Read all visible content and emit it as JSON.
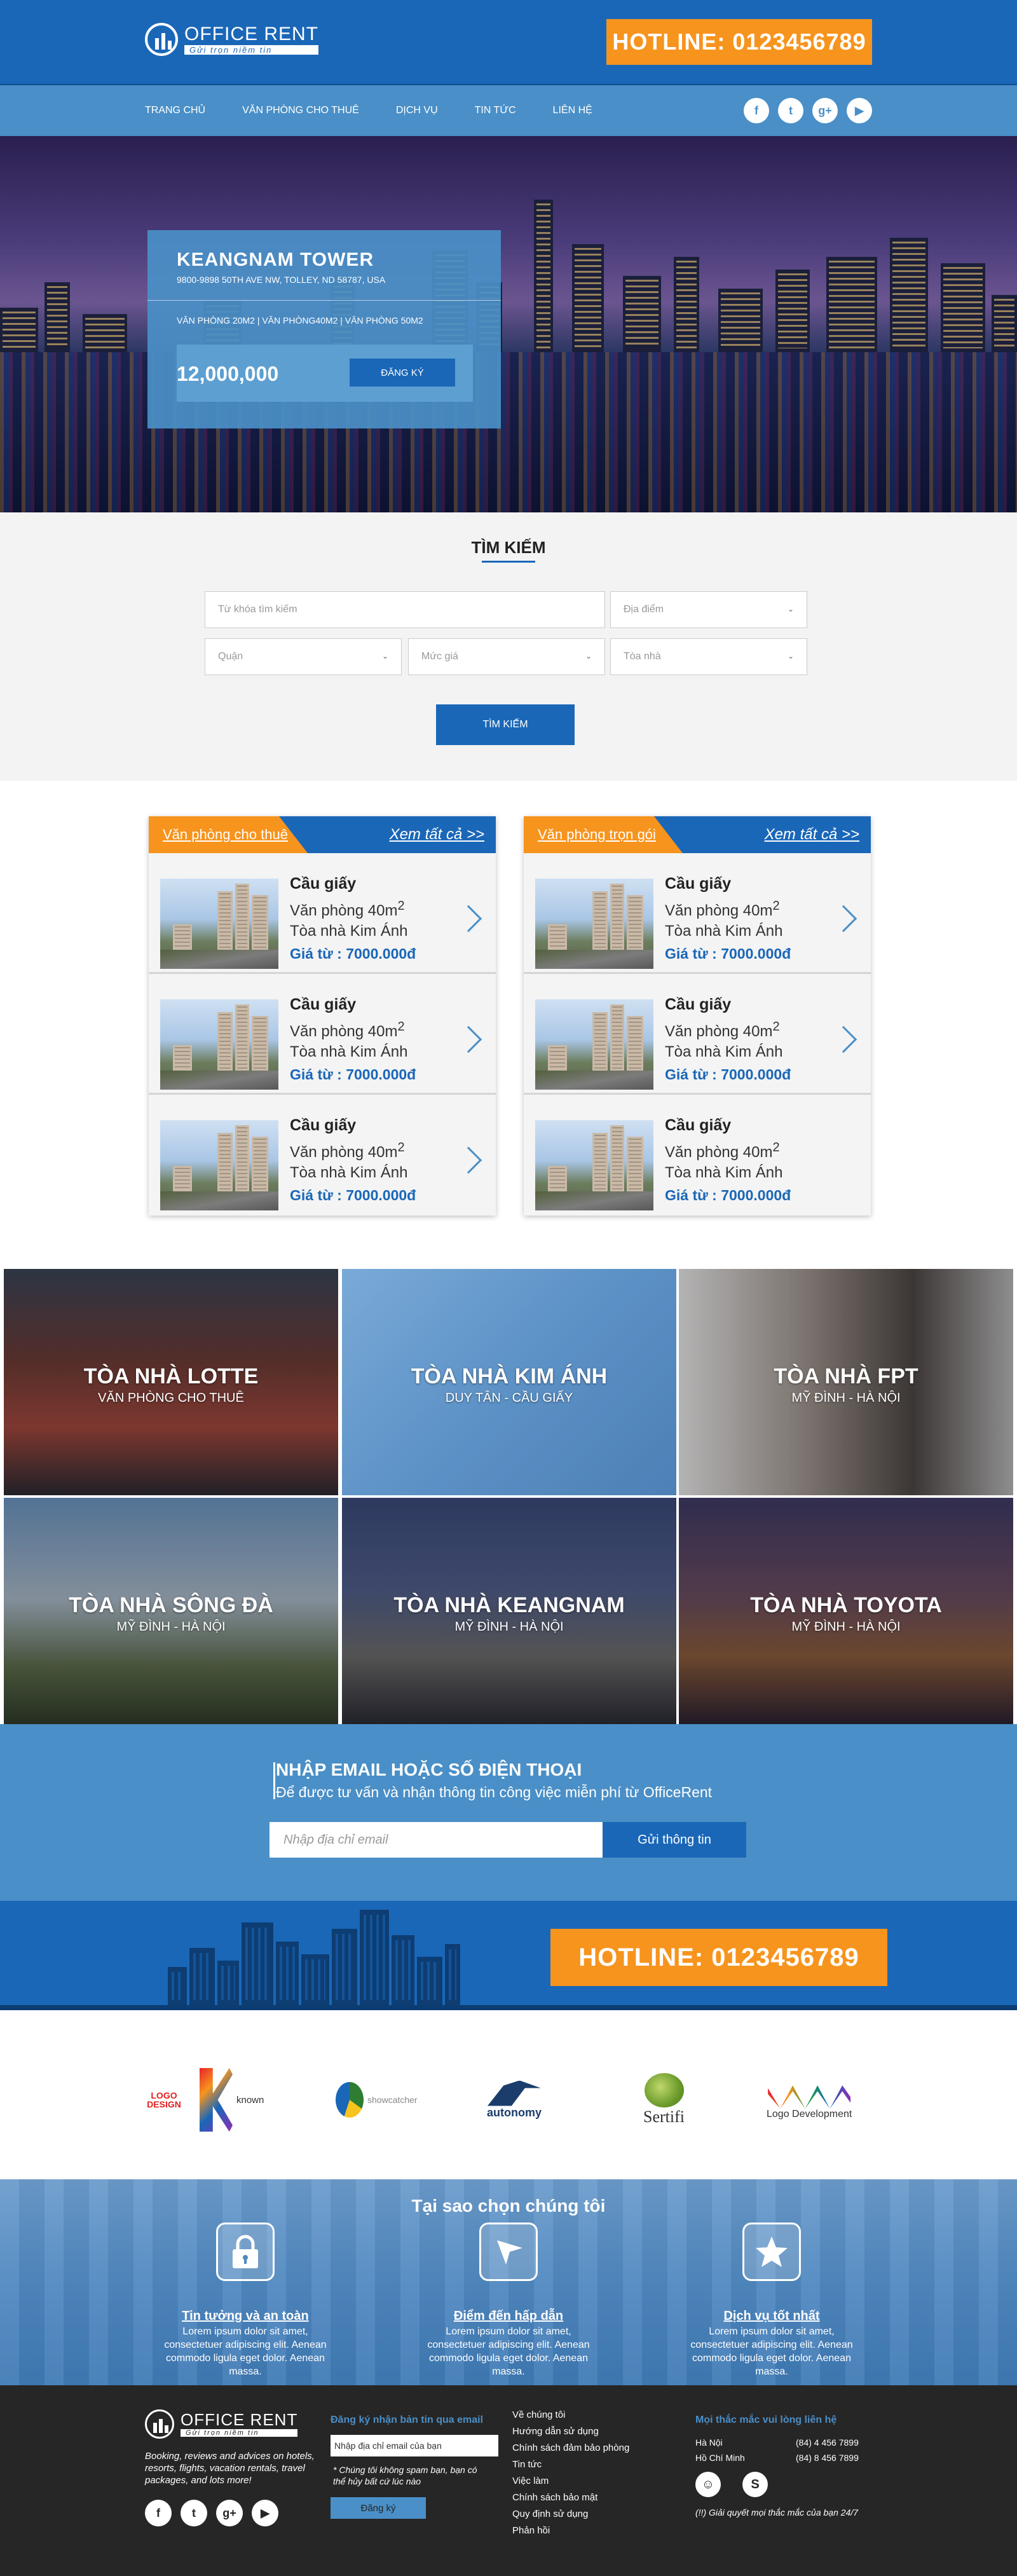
{
  "header": {
    "logo_title": "OFFICE RENT",
    "logo_tagline": "Gửi trọn niềm tin",
    "hotline": "HOTLINE: 0123456789"
  },
  "nav": {
    "items": [
      "TRANG CHỦ",
      "VĂN PHÒNG CHO THUÊ",
      "DỊCH VỤ",
      "TIN TỨC",
      "LIÊN HỆ"
    ],
    "socials": [
      {
        "icon": "facebook-icon",
        "glyph": "f"
      },
      {
        "icon": "twitter-icon",
        "glyph": "t"
      },
      {
        "icon": "google-plus-icon",
        "glyph": "g+"
      },
      {
        "icon": "youtube-icon",
        "glyph": "▶"
      }
    ]
  },
  "hero": {
    "title": "KEANGNAM TOWER",
    "address": "9800-9898 50TH AVE NW, TOLLEY, ND 58787, USA",
    "types": "VĂN PHÒNG 20M2 | VĂN PHÒNG40M2 | VĂN PHÒNG 50M2",
    "price": "12,000,000",
    "register": "ĐĂNG KÝ"
  },
  "search": {
    "title": "TÌM KIẾM",
    "keyword_placeholder": "Từ khóa tìm kiếm",
    "location": "Địa điểm",
    "district": "Quận",
    "price": "Mức giá",
    "building": "Tòa nhà",
    "button": "TÌM KIẾM"
  },
  "listings": [
    {
      "tab": "Văn phòng cho thuê",
      "view_all": "Xem tất cả >>",
      "items": [
        {
          "title": "Cầu giấy",
          "size": "Văn phòng 40m",
          "size_sup": "2",
          "building": "Tòa nhà Kim Ánh",
          "price": "Giá từ : 7000.000đ"
        },
        {
          "title": "Cầu giấy",
          "size": "Văn phòng 40m",
          "size_sup": "2",
          "building": "Tòa nhà Kim Ánh",
          "price": "Giá từ : 7000.000đ"
        },
        {
          "title": "Cầu giấy",
          "size": "Văn phòng 40m",
          "size_sup": "2",
          "building": "Tòa nhà Kim Ánh",
          "price": "Giá từ : 7000.000đ"
        }
      ]
    },
    {
      "tab": "Văn  phòng trọn gói",
      "view_all": "Xem tất cả >>",
      "items": [
        {
          "title": "Cầu giấy",
          "size": "Văn phòng 40m",
          "size_sup": "2",
          "building": "Tòa nhà Kim Ánh",
          "price": "Giá từ : 7000.000đ"
        },
        {
          "title": "Cầu giấy",
          "size": "Văn phòng 40m",
          "size_sup": "2",
          "building": "Tòa nhà Kim Ánh",
          "price": "Giá từ : 7000.000đ"
        },
        {
          "title": "Cầu giấy",
          "size": "Văn phòng 40m",
          "size_sup": "2",
          "building": "Tòa nhà Kim Ánh",
          "price": "Giá từ : 7000.000đ"
        }
      ]
    }
  ],
  "buildings": [
    {
      "name": "TÒA NHÀ LOTTE",
      "sub": "VĂN PHÒNG CHO THUÊ"
    },
    {
      "name": "TÒA NHÀ KIM ÁNH",
      "sub": "DUY TÂN - CẦU GIẤY"
    },
    {
      "name": "TÒA NHÀ FPT",
      "sub": "MỸ ĐÌNH - HÀ NỘI"
    },
    {
      "name": "TÒA NHÀ SÔNG ĐÀ",
      "sub": "MỸ ĐÌNH - HÀ NỘI"
    },
    {
      "name": "TÒA NHÀ KEANGNAM",
      "sub": "MỸ ĐÌNH - HÀ NỘI"
    },
    {
      "name": "TÒA NHÀ TOYOTA",
      "sub": "MỸ ĐÌNH - HÀ NỘI"
    }
  ],
  "subscribe": {
    "title": "NHẬP EMAIL HOẶC SỐ ĐIỆN THOẠI",
    "desc": "Để được tư vấn và nhận thông tin công việc miễn phí từ OfficeRent",
    "placeholder": "Nhập địa chỉ email",
    "button": "Gửi thông tin"
  },
  "band": {
    "hotline": "HOTLINE: 0123456789"
  },
  "partners": [
    {
      "icon": "logo-design-logo",
      "label": "LOGO DESIGN"
    },
    {
      "icon": "known-logo",
      "label": "known"
    },
    {
      "icon": "showcatcher-logo",
      "label": "showcatcher"
    },
    {
      "icon": "autonomy-logo",
      "label": "autonomy"
    },
    {
      "icon": "sertifi-logo",
      "label": "Sertifi"
    },
    {
      "icon": "logo-development-logo",
      "label": "Logo Development"
    }
  ],
  "why": {
    "title": "Tại sao chọn chúng tôi",
    "features": [
      {
        "icon": "lock-icon",
        "title": "Tin tưởng và an toàn",
        "desc": "Lorem ipsum dolor sit amet, consectetuer adipiscing elit. Aenean commodo ligula eget dolor. Aenean massa."
      },
      {
        "icon": "navigation-arrow-icon",
        "title": "Điểm đến hấp dẫn",
        "desc": "Lorem ipsum dolor sit amet, consectetuer adipiscing elit. Aenean commodo ligula eget dolor. Aenean massa."
      },
      {
        "icon": "star-icon",
        "title": "Dịch vụ tốt nhất",
        "desc": "Lorem ipsum dolor sit amet, consectetuer adipiscing elit. Aenean commodo ligula eget dolor. Aenean massa."
      }
    ]
  },
  "footer": {
    "about": "Booking, reviews and advices on hotels, resorts, flights, vacation rentals, travel packages, and lots more!",
    "newsletter_title": "Đăng ký nhận bản tin qua email",
    "newsletter_placeholder": "Nhập địa chỉ email của bạn",
    "newsletter_note": "* Chúng tôi không spam bạn, bạn có thể hủy bất cứ lúc nào",
    "newsletter_button": "Đăng ký",
    "links": [
      "Về chúng tôi",
      "Hướng dẫn sử dụng",
      "Chính sách đảm bảo phòng",
      "Tin tức",
      "Việc làm",
      "Chính sách bảo mật",
      "Quy định sử dụng",
      "Phản hồi"
    ],
    "contact_title": "Mọi thắc mắc vui lòng liên hệ",
    "contacts": [
      {
        "city": "Hà Nội",
        "phone": "(84) 4 456 7899"
      },
      {
        "city": "Hồ Chí Minh",
        "phone": "(84) 8 456 7899"
      }
    ],
    "support_note": "(!!) Giải quyết mọi thắc mắc của bạn 24/7"
  }
}
